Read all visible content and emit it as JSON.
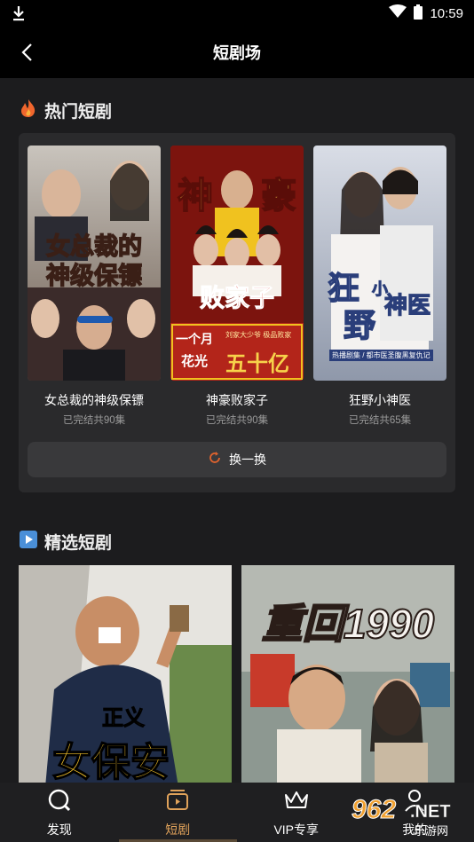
{
  "status_bar": {
    "time": "10:59"
  },
  "header": {
    "title": "短剧场"
  },
  "hot_section": {
    "title": "热门短剧",
    "items": [
      {
        "title": "女总裁的神级保镖",
        "status": "已完结共90集",
        "poster_text": [
          "女总裁的",
          "神级保镖"
        ]
      },
      {
        "title": "神豪败家子",
        "status": "已完结共90集",
        "poster_text": [
          "神",
          "豪",
          "败家子",
          "一个月",
          "花光",
          "五十亿",
          "刘家大少爷 极品败家"
        ]
      },
      {
        "title": "狂野小神医",
        "status": "已完结共65集",
        "poster_text": [
          "狂",
          "小",
          "野",
          "神医",
          "热播剧集 / 都市医圣腹黑复仇记"
        ]
      }
    ],
    "refresh_label": "换一换"
  },
  "featured_section": {
    "title": "精选短剧",
    "items": [
      {
        "poster_text": [
          "正义",
          "女保安"
        ]
      },
      {
        "poster_text": [
          "重回1990"
        ]
      }
    ]
  },
  "bottom_nav": {
    "tabs": [
      {
        "label": "发现",
        "icon": "discover-icon",
        "active": false
      },
      {
        "label": "短剧",
        "icon": "drama-icon",
        "active": true
      },
      {
        "label": "VIP专享",
        "icon": "crown-icon",
        "active": false
      },
      {
        "label": "我的",
        "icon": "user-icon",
        "active": false
      }
    ]
  },
  "watermark": {
    "brand": "962",
    "net": ".NET",
    "sub": "乐游网"
  },
  "colors": {
    "accent": "#e0a25a",
    "background": "#1c1c1e",
    "card": "#2a2a2c",
    "refresh_icon": "#e0632e"
  }
}
